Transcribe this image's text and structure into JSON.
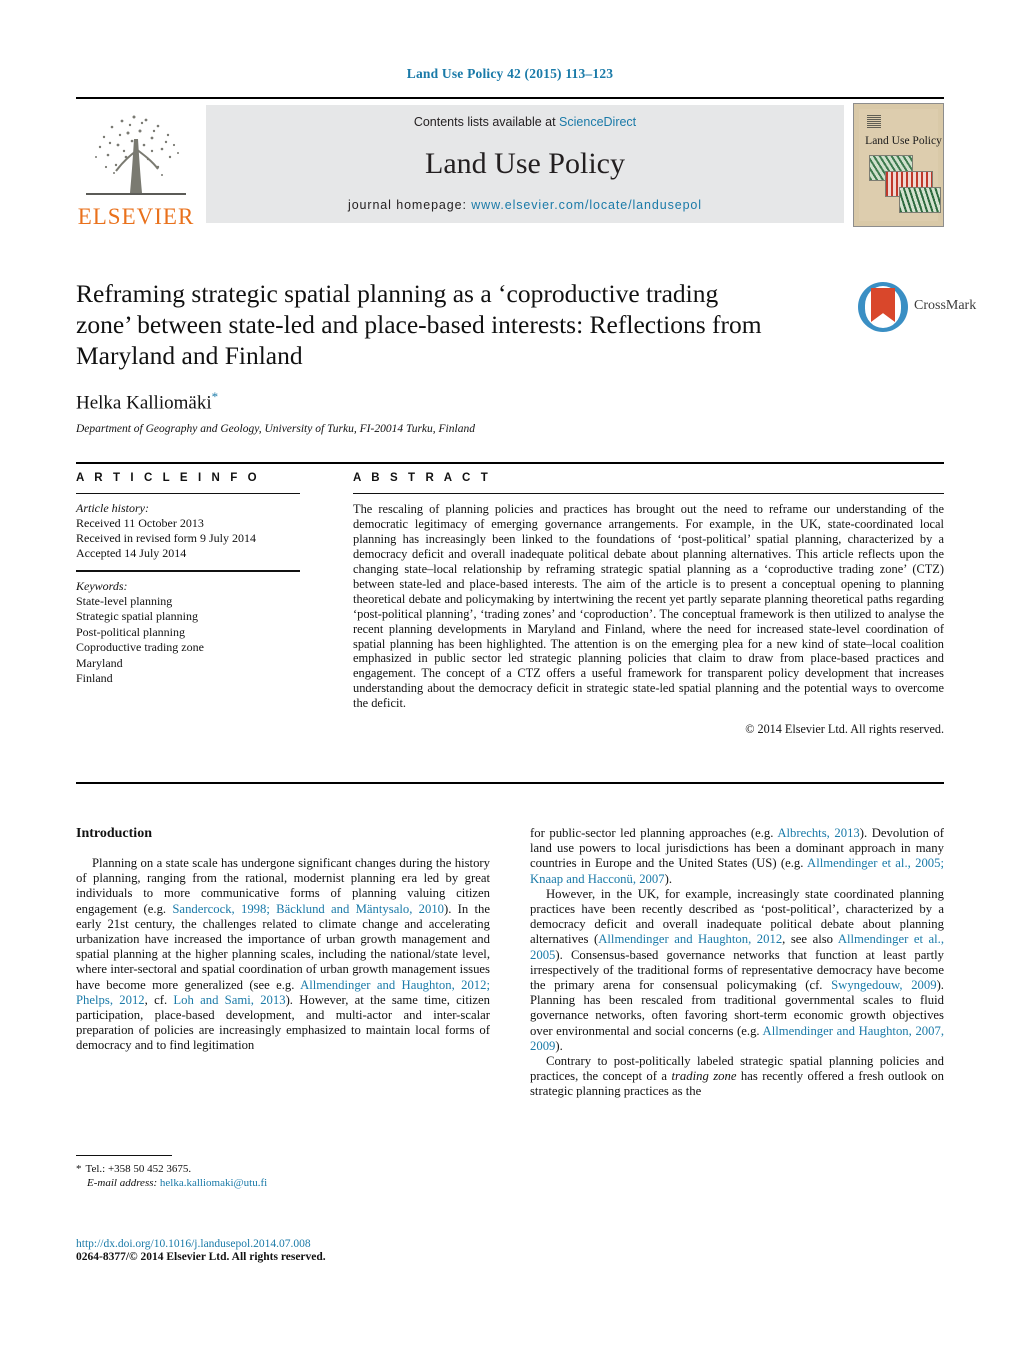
{
  "running_head": "Land Use Policy 42 (2015) 113–123",
  "masthead": {
    "contents_prefix": "Contents lists available at ",
    "sciencedirect": "ScienceDirect",
    "journal_title": "Land Use Policy",
    "homepage_label": "journal homepage: ",
    "homepage_url": "www.elsevier.com/locate/landusepol",
    "publisher": "ELSEVIER",
    "cover_title": "Land Use Policy",
    "link_color": "#1a7aa8",
    "publisher_color": "#E9711C"
  },
  "article": {
    "title": "Reframing strategic spatial planning as a ‘coproductive trading zone’ between state-led and place-based interests: Reflections from Maryland and Finland",
    "author": "Helka Kalliomäki",
    "author_marker": "*",
    "affiliation": "Department of Geography and Geology, University of Turku, FI-20014 Turku, Finland",
    "crossmark_label": "CrossMark"
  },
  "info": {
    "heading": "A R T I C L E   I N F O",
    "history_label": "Article history:",
    "history": [
      "Received 11 October 2013",
      "Received in revised form 9 July 2014",
      "Accepted 14 July 2014"
    ],
    "keywords_label": "Keywords:",
    "keywords": [
      "State-level planning",
      "Strategic spatial planning",
      "Post-political planning",
      "Coproductive trading zone",
      "Maryland",
      "Finland"
    ]
  },
  "abstract": {
    "heading": "A B S T R A C T",
    "text": "The rescaling of planning policies and practices has brought out the need to reframe our understanding of the democratic legitimacy of emerging governance arrangements. For example, in the UK, state-coordinated local planning has increasingly been linked to the foundations of ‘post-political’ spatial planning, characterized by a democracy deficit and overall inadequate political debate about planning alternatives. This article reflects upon the changing state–local relationship by reframing strategic spatial planning as a ‘coproductive trading zone’ (CTZ) between state-led and place-based interests. The aim of the article is to present a conceptual opening to planning theoretical debate and policymaking by intertwining the recent yet partly separate planning theoretical paths regarding ‘post-political planning’, ‘trading zones’ and ‘coproduction’. The conceptual framework is then utilized to analyse the recent planning developments in Maryland and Finland, where the need for increased state-level coordination of spatial planning has been highlighted. The attention is on the emerging plea for a new kind of state–local coalition emphasized in public sector led strategic planning policies that claim to draw from place-based practices and engagement. The concept of a CTZ offers a useful framework for transparent policy development that increases understanding about the democracy deficit in strategic state-led spatial planning and the potential ways to overcome the deficit.",
    "copyright": "© 2014 Elsevier Ltd. All rights reserved."
  },
  "body": {
    "section_heading": "Introduction",
    "left_paragraphs": [
      {
        "segments": [
          {
            "t": "Planning on a state scale has undergone significant changes during the history of planning, ranging from the rational, modernist planning era led by great individuals to more communicative forms of planning valuing citizen engagement (e.g. ",
            "k": "text"
          },
          {
            "t": "Sandercock, 1998; Bäcklund and Mäntysalo, 2010",
            "k": "ref"
          },
          {
            "t": "). In the early 21st century, the challenges related to climate change and accelerating urbanization have increased the importance of urban growth management and spatial planning at the higher planning scales, including the national/state level, where inter-sectoral and spatial coordination of urban growth management issues have become more generalized (see e.g. ",
            "k": "text"
          },
          {
            "t": "Allmendinger and Haughton, 2012; Phelps, 2012",
            "k": "ref"
          },
          {
            "t": ", cf. ",
            "k": "text"
          },
          {
            "t": "Loh and Sami, 2013",
            "k": "ref"
          },
          {
            "t": "). However, at the same time, citizen participation, place-based development, and multi-actor and inter-scalar preparation of policies are increasingly emphasized to maintain local forms of democracy and to find legitimation",
            "k": "text"
          }
        ]
      }
    ],
    "right_paragraphs": [
      {
        "indent": false,
        "segments": [
          {
            "t": "for public-sector led planning approaches (e.g. ",
            "k": "text"
          },
          {
            "t": "Albrechts, 2013",
            "k": "ref"
          },
          {
            "t": "). Devolution of land use powers to local jurisdictions has been a dominant approach in many countries in Europe and the United States (US) (e.g. ",
            "k": "text"
          },
          {
            "t": "Allmendinger et al., 2005; Knaap and Hacconü, 2007",
            "k": "ref"
          },
          {
            "t": ").",
            "k": "text"
          }
        ]
      },
      {
        "indent": true,
        "segments": [
          {
            "t": "However, in the UK, for example, increasingly state coordinated planning practices have been recently described as ‘post-political’, characterized by a democracy deficit and overall inadequate political debate about planning alternatives (",
            "k": "text"
          },
          {
            "t": "Allmendinger and Haughton, 2012",
            "k": "ref"
          },
          {
            "t": ", see also ",
            "k": "text"
          },
          {
            "t": "Allmendinger et al., 2005",
            "k": "ref"
          },
          {
            "t": "). Consensus-based governance networks that function at least partly irrespectively of the traditional forms of representative democracy have become the primary arena for consensual policymaking (cf. ",
            "k": "text"
          },
          {
            "t": "Swyngedouw, 2009",
            "k": "ref"
          },
          {
            "t": "). Planning has been rescaled from traditional governmental scales to fluid governance networks, often favoring short-term economic growth objectives over environmental and social concerns (e.g. ",
            "k": "text"
          },
          {
            "t": "Allmendinger and Haughton, 2007, 2009",
            "k": "ref"
          },
          {
            "t": ").",
            "k": "text"
          }
        ]
      },
      {
        "indent": true,
        "segments": [
          {
            "t": "Contrary to post-politically labeled strategic spatial planning policies and practices, the concept of a ",
            "k": "text"
          },
          {
            "t": "trading zone",
            "k": "ital"
          },
          {
            "t": " has recently offered a fresh outlook on strategic planning practices as the",
            "k": "text"
          }
        ]
      }
    ]
  },
  "footnotes": {
    "marker": "*",
    "tel": "Tel.: +358 50 452 3675.",
    "email_label": "E-mail address:",
    "email": "helka.kalliomaki@utu.fi"
  },
  "bottom": {
    "doi": "http://dx.doi.org/10.1016/j.landusepol.2014.07.008",
    "issn": "0264-8377/© 2014 Elsevier Ltd. All rights reserved."
  }
}
